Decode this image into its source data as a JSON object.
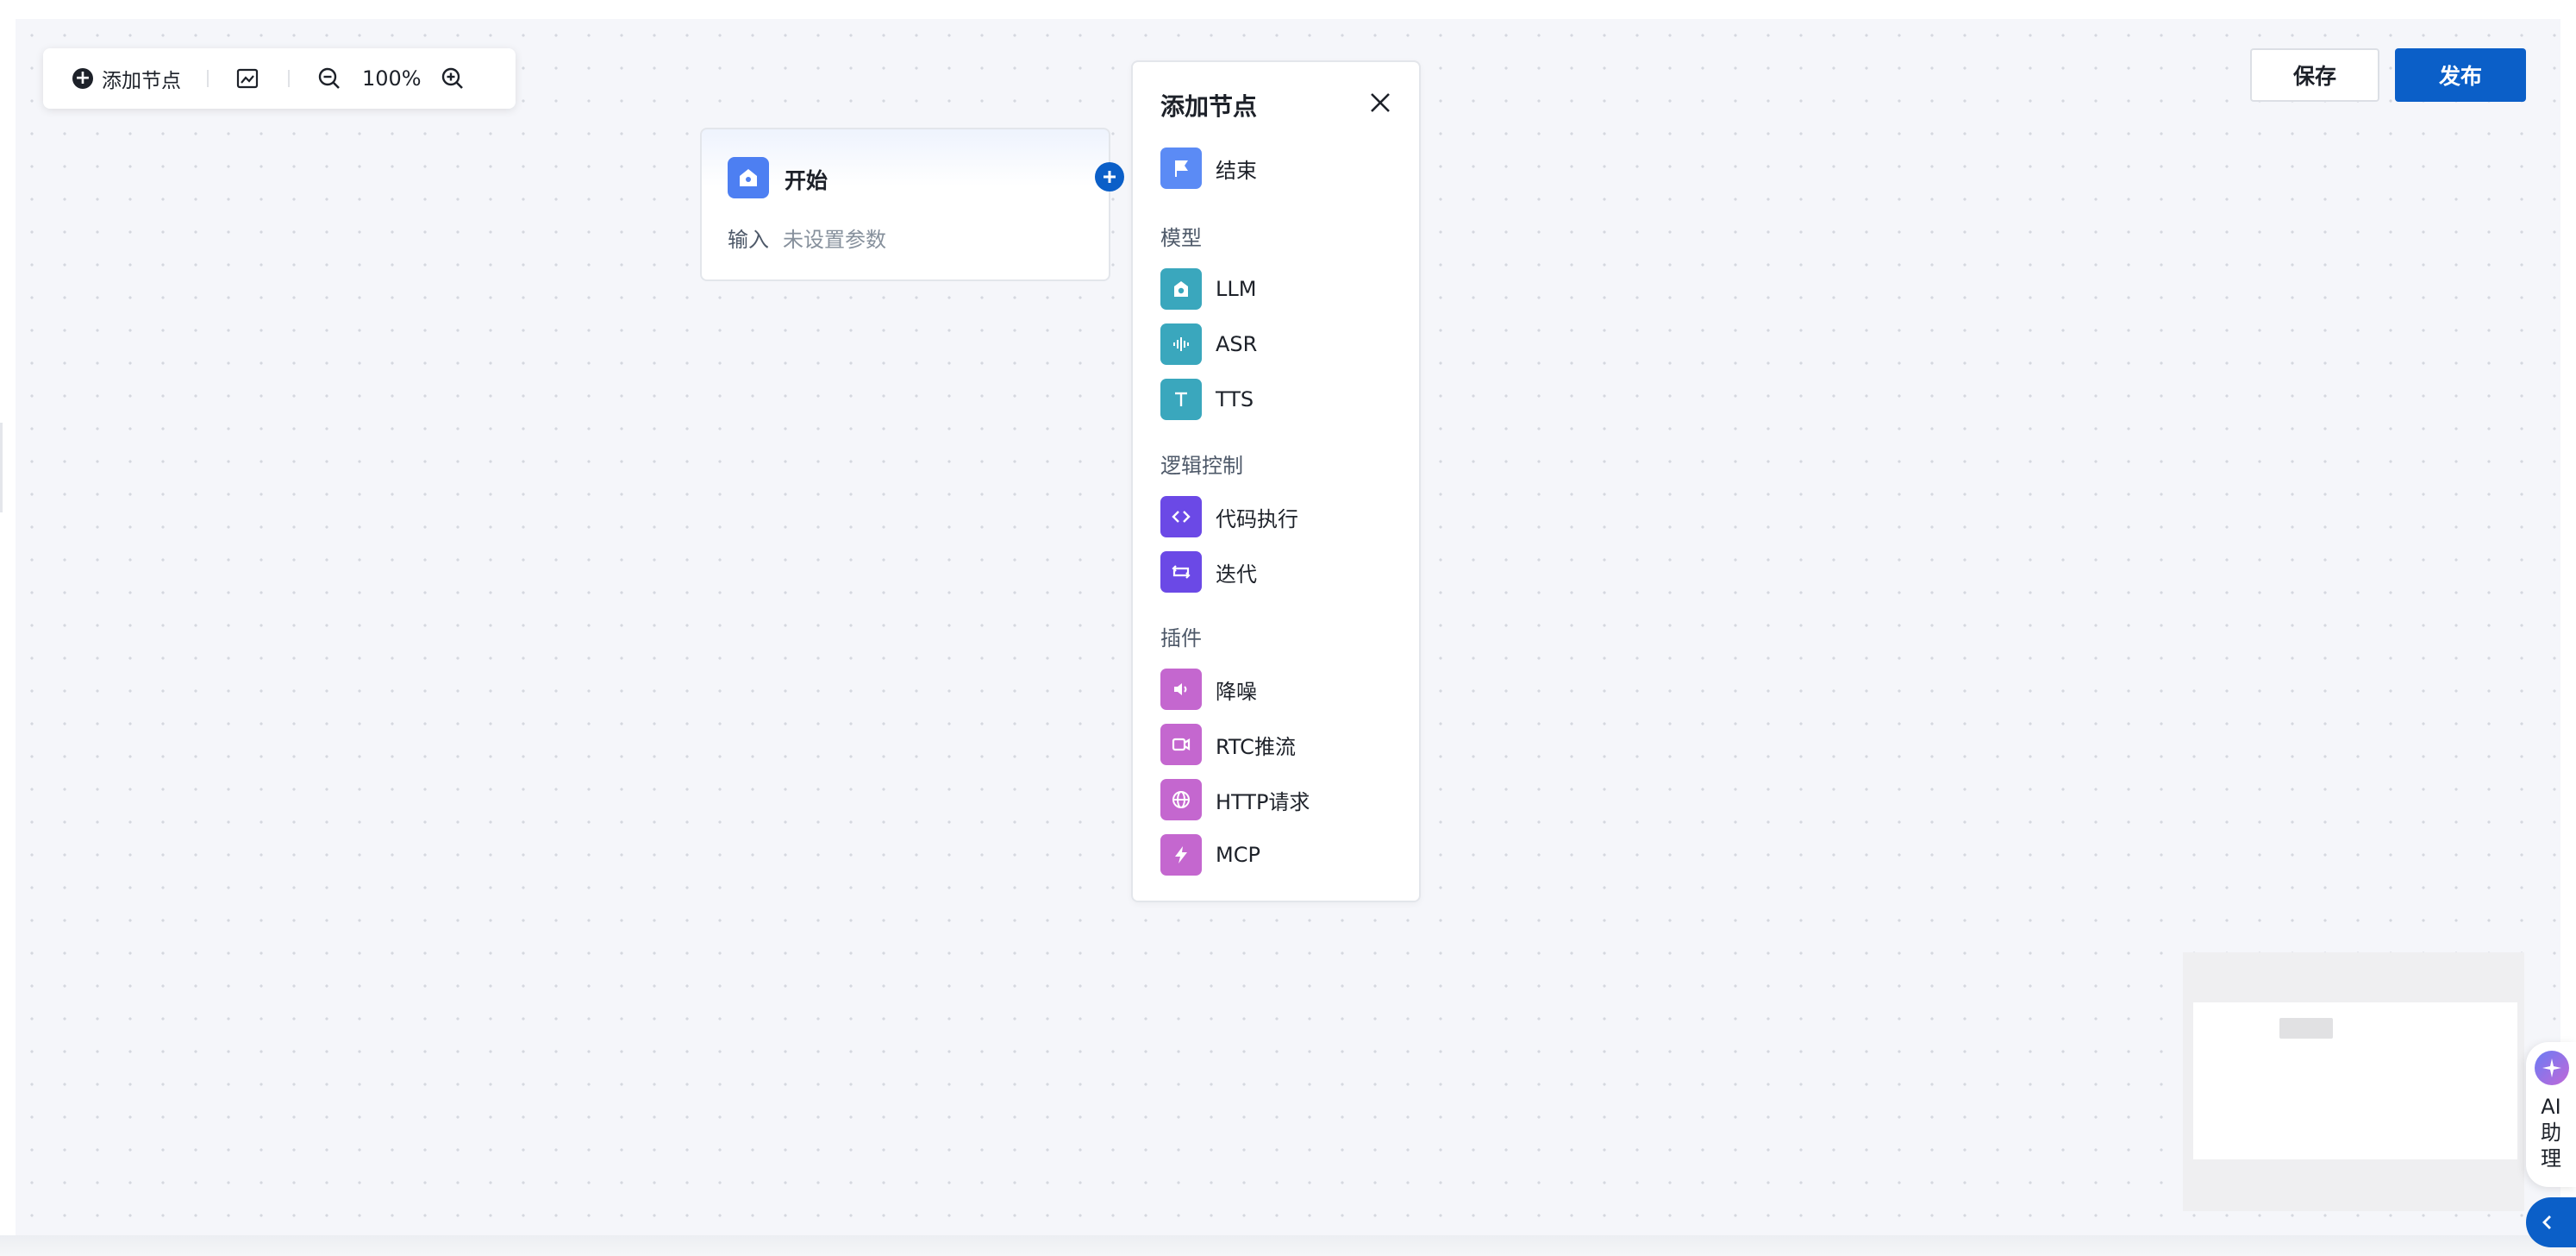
{
  "toolbar": {
    "add_node_label": "添加节点",
    "zoom_level": "100%"
  },
  "start_node": {
    "title": "开始",
    "input_label": "输入",
    "input_value": "未设置参数"
  },
  "panel": {
    "title": "添加节点",
    "top_item": {
      "label": "结束",
      "icon": "flag-icon",
      "color": "#5b8bf5"
    },
    "sections": [
      {
        "title": "模型",
        "items": [
          {
            "label": "LLM",
            "icon": "robot-icon",
            "color": "#3aa7bd"
          },
          {
            "label": "ASR",
            "icon": "waveform-icon",
            "color": "#3aa7bd"
          },
          {
            "label": "TTS",
            "icon": "text-t-icon",
            "color": "#3aa7bd"
          }
        ]
      },
      {
        "title": "逻辑控制",
        "items": [
          {
            "label": "代码执行",
            "icon": "code-icon",
            "color": "#6b49e6"
          },
          {
            "label": "迭代",
            "icon": "loop-icon",
            "color": "#6b49e6"
          }
        ]
      },
      {
        "title": "插件",
        "items": [
          {
            "label": "降噪",
            "icon": "speaker-icon",
            "color": "#c467cf"
          },
          {
            "label": "RTC推流",
            "icon": "video-icon",
            "color": "#c467cf"
          },
          {
            "label": "HTTP请求",
            "icon": "globe-icon",
            "color": "#c467cf"
          },
          {
            "label": "MCP",
            "icon": "lightning-icon",
            "color": "#c467cf"
          }
        ]
      }
    ]
  },
  "header": {
    "save_label": "保存",
    "publish_label": "发布"
  },
  "assistant": {
    "label_line1": "AI",
    "label_line2": "助",
    "label_line3": "理"
  },
  "colors": {
    "primary": "#0b5fc8",
    "start_icon": "#4d7ff2"
  }
}
